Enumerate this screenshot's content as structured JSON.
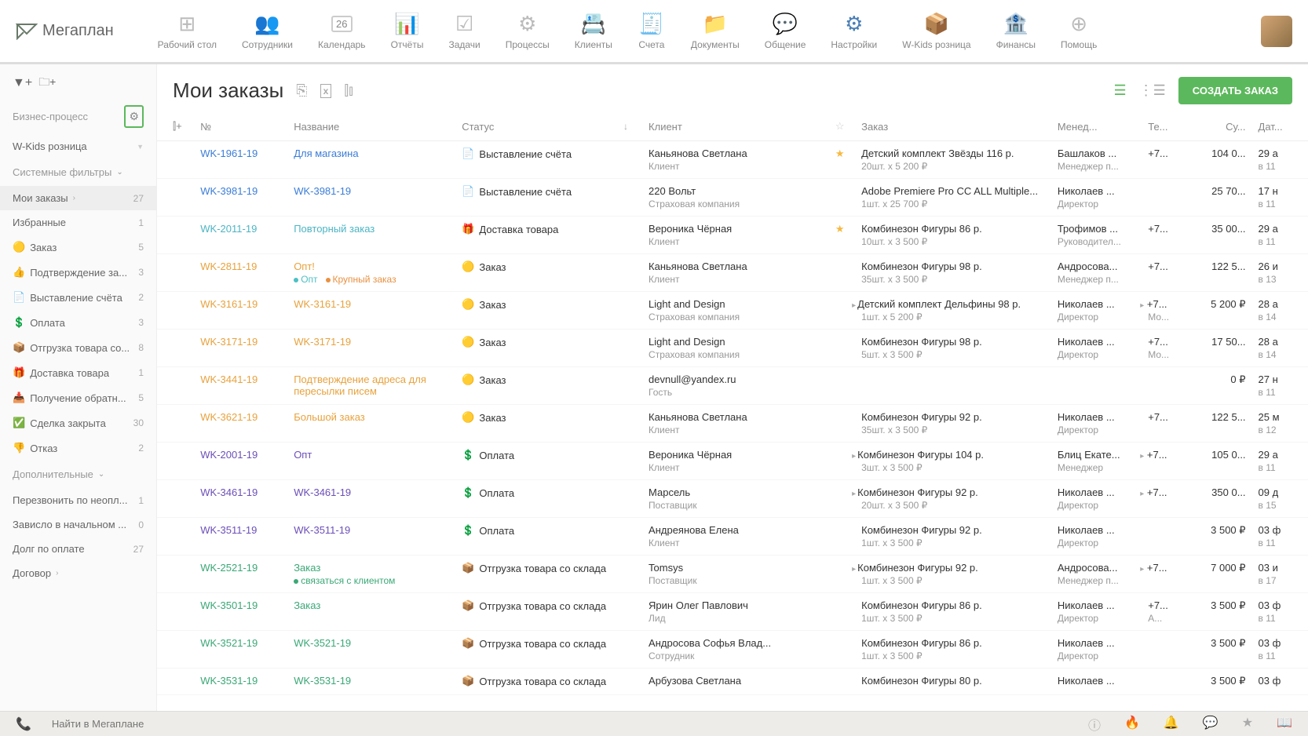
{
  "logo": "Мегаплан",
  "nav": [
    {
      "label": "Рабочий стол",
      "icon": "⊞"
    },
    {
      "label": "Сотрудники",
      "icon": "👥"
    },
    {
      "label": "Календарь",
      "icon": "📅",
      "badge": "26"
    },
    {
      "label": "Отчёты",
      "icon": "📊"
    },
    {
      "label": "Задачи",
      "icon": "☑"
    },
    {
      "label": "Процессы",
      "icon": "⚙"
    },
    {
      "label": "Клиенты",
      "icon": "📇"
    },
    {
      "label": "Счета",
      "icon": "🧾"
    },
    {
      "label": "Документы",
      "icon": "📁"
    },
    {
      "label": "Общение",
      "icon": "💬"
    },
    {
      "label": "Настройки",
      "icon": "⚙",
      "active": true
    },
    {
      "label": "W-Kids розница",
      "icon": "📦"
    },
    {
      "label": "Финансы",
      "icon": "🏦"
    },
    {
      "label": "Помощь",
      "icon": "⊕"
    }
  ],
  "sidebar": {
    "process_label": "Бизнес-процесс",
    "process_value": "W-Kids розница",
    "system_filters_label": "Системные фильтры",
    "filters": [
      {
        "label": "Мои заказы",
        "count": "27",
        "active": true,
        "chevron": true
      },
      {
        "label": "Избранные",
        "count": "1"
      },
      {
        "label": "Заказ",
        "count": "5",
        "icon": "🟡"
      },
      {
        "label": "Подтверждение за...",
        "count": "3",
        "icon": "👍"
      },
      {
        "label": "Выставление счёта",
        "count": "2",
        "icon": "📄"
      },
      {
        "label": "Оплата",
        "count": "3",
        "icon": "💲"
      },
      {
        "label": "Отгрузка товара со...",
        "count": "8",
        "icon": "📦"
      },
      {
        "label": "Доставка товара",
        "count": "1",
        "icon": "🎁"
      },
      {
        "label": "Получение обратн...",
        "count": "5",
        "icon": "📥"
      },
      {
        "label": "Сделка закрыта",
        "count": "30",
        "icon": "✅"
      },
      {
        "label": "Отказ",
        "count": "2",
        "icon": "👎"
      }
    ],
    "additional_label": "Дополнительные",
    "additional": [
      {
        "label": "Перезвонить по неопл...",
        "count": "1"
      },
      {
        "label": "Зависло в начальном ...",
        "count": "0"
      },
      {
        "label": "Долг по оплате",
        "count": "27"
      },
      {
        "label": "Договор",
        "chevron": true
      }
    ]
  },
  "page_title": "Мои заказы",
  "create_button": "СОЗДАТЬ ЗАКАЗ",
  "columns": {
    "num": "№",
    "name": "Название",
    "status": "Статус",
    "client": "Клиент",
    "order": "Заказ",
    "manager": "Менед...",
    "tel": "Те...",
    "sum": "Су...",
    "date": "Дат..."
  },
  "rows": [
    {
      "num": "WK-1961-19",
      "numClass": "link-blue",
      "name": "Для магазина",
      "nameClass": "link-blue",
      "statusIcon": "📄",
      "status": "Выставление счёта",
      "client": "Каньянова Светлана",
      "clientSub": "Клиент",
      "star": "gold",
      "order": "Детский комплект Звёзды 116 р.",
      "orderSub": "20шт. x 5 200 ₽",
      "manager": "Башлаков ...",
      "managerSub": "Менеджер п...",
      "tel": "+7...",
      "sum": "104 0...",
      "date": "29 а",
      "dateSub": "в 11"
    },
    {
      "num": "WK-3981-19",
      "numClass": "link-blue",
      "name": "WK-3981-19",
      "nameClass": "link-blue",
      "statusIcon": "📄",
      "status": "Выставление счёта",
      "client": "220 Вольт",
      "clientSub": "Страховая компания",
      "order": "Adobe Premiere Pro CC ALL Multiple...",
      "orderSub": "1шт. x 25 700 ₽",
      "manager": "Николаев ...",
      "managerSub": "Директор",
      "tel": "",
      "sum": "25 70...",
      "date": "17 н",
      "dateSub": "в 11"
    },
    {
      "num": "WK-2011-19",
      "numClass": "link-cyan",
      "name": "Повторный заказ",
      "nameClass": "link-cyan",
      "statusIcon": "🎁",
      "status": "Доставка товара",
      "client": "Вероника Чёрная",
      "clientSub": "Клиент",
      "star": "gold",
      "order": "Комбинезон Фигуры 86 р.",
      "orderSub": "10шт. x 3 500 ₽",
      "manager": "Трофимов ...",
      "managerSub": "Руководител...",
      "tel": "+7...",
      "sum": "35 00...",
      "date": "29 а",
      "dateSub": "в 11"
    },
    {
      "num": "WK-2811-19",
      "numClass": "link-orange",
      "name": "Опт!",
      "nameClass": "link-orange",
      "tags": [
        {
          "color": "#4cc0c4",
          "text": "Опт"
        },
        {
          "color": "#e89040",
          "text": "Крупный заказ"
        }
      ],
      "statusIcon": "🟡",
      "status": "Заказ",
      "client": "Каньянова Светлана",
      "clientSub": "Клиент",
      "order": "Комбинезон Фигуры 98 р.",
      "orderSub": "35шт. x 3 500 ₽",
      "manager": "Андросова...",
      "managerSub": "Менеджер п...",
      "tel": "+7...",
      "sum": "122 5...",
      "date": "26 и",
      "dateSub": "в 13"
    },
    {
      "num": "WK-3161-19",
      "numClass": "link-orange",
      "name": "WK-3161-19",
      "nameClass": "link-orange",
      "statusIcon": "🟡",
      "status": "Заказ",
      "client": "Light and Design",
      "clientSub": "Страховая компания",
      "order": "Детский комплект Дельфины 98 р.",
      "orderSub": "1шт. x 5 200 ₽",
      "expand": true,
      "manager": "Николаев ...",
      "managerSub": "Директор",
      "tel": "+7...",
      "telSub": "Мо...",
      "sum": "5 200 ₽",
      "date": "28 а",
      "dateSub": "в 14"
    },
    {
      "num": "WK-3171-19",
      "numClass": "link-orange",
      "name": "WK-3171-19",
      "nameClass": "link-orange",
      "statusIcon": "🟡",
      "status": "Заказ",
      "client": "Light and Design",
      "clientSub": "Страховая компания",
      "order": "Комбинезон Фигуры 98 р.",
      "orderSub": "5шт. x 3 500 ₽",
      "manager": "Николаев ...",
      "managerSub": "Директор",
      "tel": "+7...",
      "telSub": "Мо...",
      "sum": "17 50...",
      "date": "28 а",
      "dateSub": "в 14"
    },
    {
      "num": "WK-3441-19",
      "numClass": "link-orange",
      "name": "Подтверждение адреса для пересылки писем",
      "nameClass": "link-orange",
      "statusIcon": "🟡",
      "status": "Заказ",
      "client": "devnull@yandex.ru",
      "clientSub": "Гость",
      "order": "",
      "orderSub": "",
      "manager": "",
      "managerSub": "",
      "tel": "",
      "sum": "0 ₽",
      "date": "27 н",
      "dateSub": "в 11"
    },
    {
      "num": "WK-3621-19",
      "numClass": "link-orange",
      "name": "Большой заказ",
      "nameClass": "link-orange",
      "statusIcon": "🟡",
      "status": "Заказ",
      "client": "Каньянова Светлана",
      "clientSub": "Клиент",
      "order": "Комбинезон Фигуры 92 р.",
      "orderSub": "35шт. x 3 500 ₽",
      "manager": "Николаев ...",
      "managerSub": "Директор",
      "tel": "+7...",
      "sum": "122 5...",
      "date": "25 м",
      "dateSub": "в 12"
    },
    {
      "num": "WK-2001-19",
      "numClass": "link-purple",
      "name": "Опт",
      "nameClass": "link-purple",
      "statusIcon": "💲",
      "status": "Оплата",
      "client": "Вероника Чёрная",
      "clientSub": "Клиент",
      "order": "Комбинезон Фигуры 104 р.",
      "orderSub": "3шт. x 3 500 ₽",
      "expand": true,
      "manager": "Блиц Екате...",
      "managerSub": "Менеджер",
      "tel": "+7...",
      "sum": "105 0...",
      "date": "29 а",
      "dateSub": "в 11"
    },
    {
      "num": "WK-3461-19",
      "numClass": "link-purple",
      "name": "WK-3461-19",
      "nameClass": "link-purple",
      "statusIcon": "💲",
      "status": "Оплата",
      "client": "Марсель",
      "clientSub": "Поставщик",
      "order": "Комбинезон Фигуры 92 р.",
      "orderSub": "20шт. x 3 500 ₽",
      "expand": true,
      "manager": "Николаев ...",
      "managerSub": "Директор",
      "tel": "+7...",
      "sum": "350 0...",
      "date": "09 д",
      "dateSub": "в 15"
    },
    {
      "num": "WK-3511-19",
      "numClass": "link-purple",
      "name": "WK-3511-19",
      "nameClass": "link-purple",
      "statusIcon": "💲",
      "status": "Оплата",
      "client": "Андреянова Елена",
      "clientSub": "Клиент",
      "order": "Комбинезон Фигуры 92 р.",
      "orderSub": "1шт. x 3 500 ₽",
      "manager": "Николаев ...",
      "managerSub": "Директор",
      "tel": "",
      "sum": "3 500 ₽",
      "date": "03 ф",
      "dateSub": "в 11"
    },
    {
      "num": "WK-2521-19",
      "numClass": "link-green",
      "name": "Заказ",
      "nameClass": "link-green",
      "tags": [
        {
          "color": "#3aa876",
          "text": "связаться с клиентом"
        }
      ],
      "statusIcon": "📦",
      "status": "Отгрузка товара со склада",
      "client": "Tomsys",
      "clientSub": "Поставщик",
      "order": "Комбинезон Фигуры 92 р.",
      "orderSub": "1шт. x 3 500 ₽",
      "expand": true,
      "manager": "Андросова...",
      "managerSub": "Менеджер п...",
      "tel": "+7...",
      "sum": "7 000 ₽",
      "date": "03 и",
      "dateSub": "в 17"
    },
    {
      "num": "WK-3501-19",
      "numClass": "link-green",
      "name": "Заказ",
      "nameClass": "link-green",
      "statusIcon": "📦",
      "status": "Отгрузка товара со склада",
      "client": "Ярин Олег Павлович",
      "clientSub": "Лид",
      "order": "Комбинезон Фигуры 86 р.",
      "orderSub": "1шт. x 3 500 ₽",
      "manager": "Николаев ...",
      "managerSub": "Директор",
      "tel": "+7...",
      "telSub": "А...",
      "sum": "3 500 ₽",
      "date": "03 ф",
      "dateSub": "в 11"
    },
    {
      "num": "WK-3521-19",
      "numClass": "link-green",
      "name": "WK-3521-19",
      "nameClass": "link-green",
      "statusIcon": "📦",
      "status": "Отгрузка товара со склада",
      "client": "Андросова Софья Влад...",
      "clientSub": "Сотрудник",
      "order": "Комбинезон Фигуры 86 р.",
      "orderSub": "1шт. x 3 500 ₽",
      "manager": "Николаев ...",
      "managerSub": "Директор",
      "tel": "",
      "sum": "3 500 ₽",
      "date": "03 ф",
      "dateSub": "в 11"
    },
    {
      "num": "WK-3531-19",
      "numClass": "link-green",
      "name": "WK-3531-19",
      "nameClass": "link-green",
      "statusIcon": "📦",
      "status": "Отгрузка товара со склада",
      "client": "Арбузова Светлана",
      "clientSub": "",
      "order": "Комбинезон Фигуры 80 р.",
      "orderSub": "",
      "manager": "Николаев ...",
      "managerSub": "",
      "tel": "",
      "sum": "3 500 ₽",
      "date": "03 ф",
      "dateSub": ""
    }
  ],
  "search_placeholder": "Найти в Мегаплане"
}
